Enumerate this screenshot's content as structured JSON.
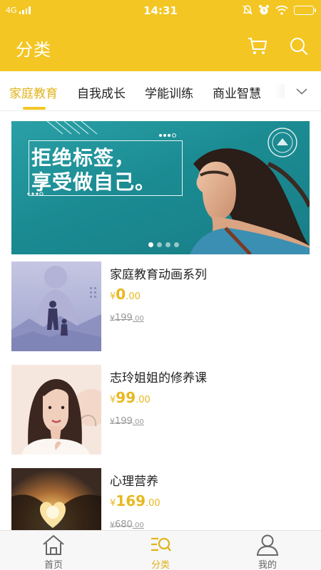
{
  "status_bar": {
    "network": "4G",
    "time": "14:31"
  },
  "header": {
    "title": "分类",
    "cart_icon": "cart-icon",
    "search_icon": "search-icon"
  },
  "tabs": [
    {
      "label": "家庭教育",
      "active": true
    },
    {
      "label": "自我成长",
      "active": false
    },
    {
      "label": "学能训练",
      "active": false
    },
    {
      "label": "商业智慧",
      "active": false
    }
  ],
  "banner": {
    "line1": "拒绝标签，",
    "line2": "享受做自己。",
    "slide_count": 4,
    "active_slide": 1
  },
  "products": [
    {
      "title": "家庭教育动画系列",
      "price_symbol": "¥",
      "price_int": "0",
      "price_dec": ".00",
      "orig_symbol": "¥",
      "orig_int": "199",
      "orig_dec": ".00"
    },
    {
      "title": "志玲姐姐的修养课",
      "price_symbol": "¥",
      "price_int": "99",
      "price_dec": ".00",
      "orig_symbol": "¥",
      "orig_int": "199",
      "orig_dec": ".00"
    },
    {
      "title": "心理营养",
      "price_symbol": "¥",
      "price_int": "169",
      "price_dec": ".00",
      "orig_symbol": "¥",
      "orig_int": "680",
      "orig_dec": ".00"
    }
  ],
  "bottom_nav": [
    {
      "label": "首页",
      "icon": "home-icon",
      "active": false
    },
    {
      "label": "分类",
      "icon": "category-search-icon",
      "active": true
    },
    {
      "label": "我的",
      "icon": "user-icon",
      "active": false
    }
  ],
  "colors": {
    "brand_yellow": "#f3c623",
    "accent_text": "#e0b31a",
    "price": "#e8b81f",
    "banner_teal": "#1b8b92"
  }
}
